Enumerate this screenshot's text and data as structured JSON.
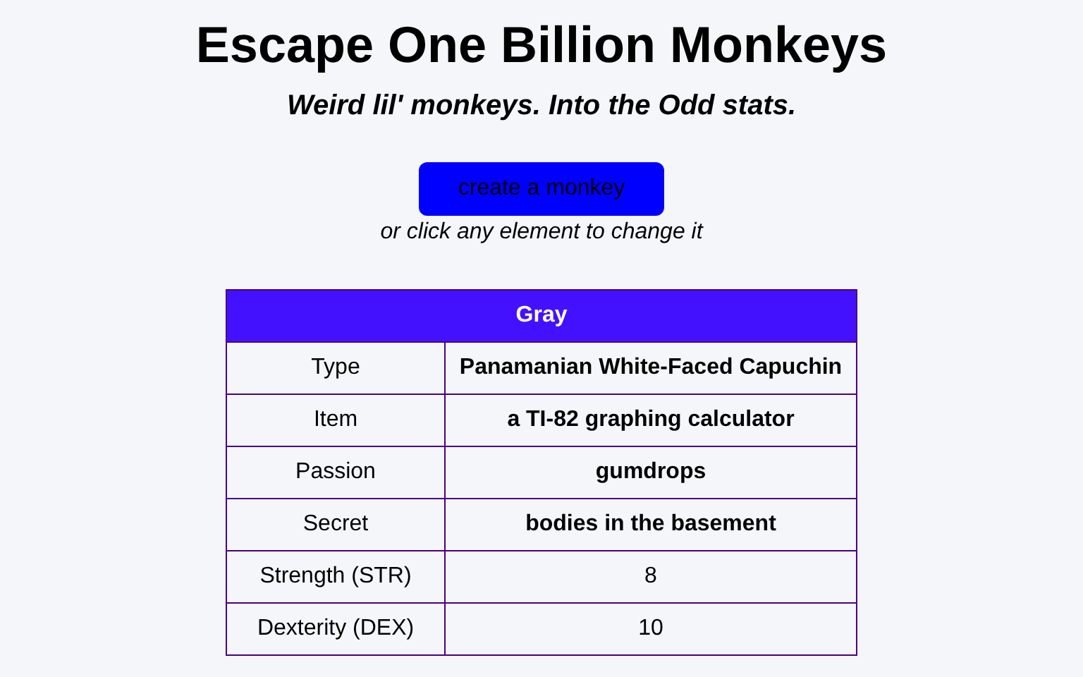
{
  "title": "Escape One Billion Monkeys",
  "subtitle": "Weird lil' monkeys. Into the Odd stats.",
  "create_button": "create a monkey",
  "hint": "or click any element to change it",
  "table": {
    "header": "Gray",
    "rows": [
      {
        "kind": "trait",
        "label": "Type",
        "value": "Panamanian White-Faced Capuchin"
      },
      {
        "kind": "trait",
        "label": "Item",
        "value": "a TI-82 graphing calculator"
      },
      {
        "kind": "trait",
        "label": "Passion",
        "value": "gumdrops"
      },
      {
        "kind": "trait",
        "label": "Secret",
        "value": "bodies in the basement"
      },
      {
        "kind": "stat",
        "label": "Strength (STR)",
        "value": "8"
      },
      {
        "kind": "stat",
        "label": "Dexterity (DEX)",
        "value": "10"
      }
    ]
  }
}
